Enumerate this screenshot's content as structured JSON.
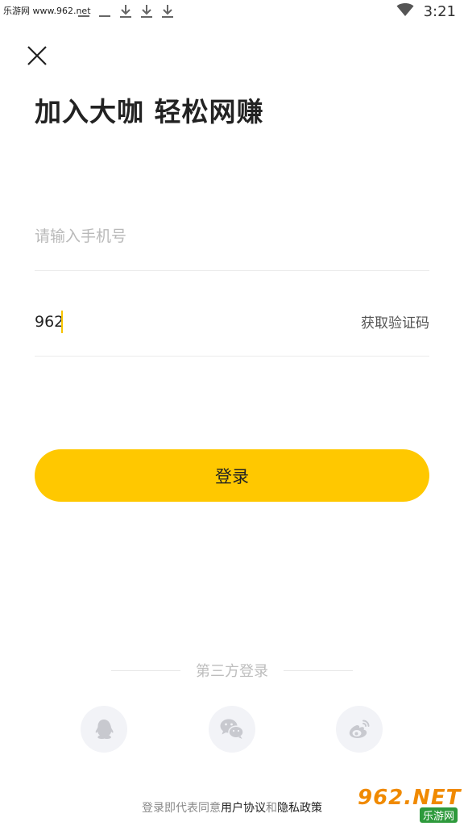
{
  "status_bar": {
    "watermark": "乐游网 www.962.net",
    "time": "3:21",
    "icons": [
      "notification-icon",
      "notification-icon",
      "notification-icon",
      "download-icon",
      "download-icon",
      "download-icon",
      "wifi-icon"
    ]
  },
  "header": {
    "close_icon": "close-icon",
    "title": "加入大咖 轻松网赚"
  },
  "form": {
    "phone": {
      "value": "",
      "placeholder": "请输入手机号"
    },
    "code": {
      "value": "962",
      "placeholder": ""
    },
    "get_code_label": "获取验证码",
    "login_label": "登录"
  },
  "third_party": {
    "label": "第三方登录",
    "providers": [
      {
        "icon": "qq-icon"
      },
      {
        "icon": "wechat-icon"
      },
      {
        "icon": "weibo-icon"
      }
    ]
  },
  "agreement": {
    "prefix": "登录即代表同意",
    "user_agreement": "用户协议",
    "and": "和",
    "privacy_policy": "隐私政策"
  },
  "watermark_logo": {
    "big": "962.NET",
    "small": "乐游网"
  },
  "colors": {
    "accent": "#ffc800",
    "caret": "#f7c400",
    "social_bg": "#f2f3f7",
    "social_icon": "#c8c9cf"
  }
}
